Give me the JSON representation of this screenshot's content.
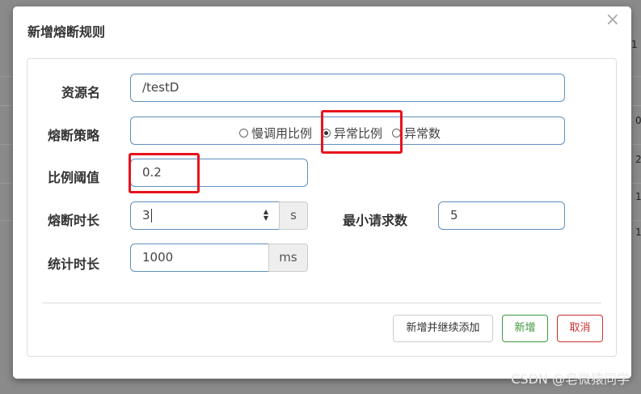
{
  "dialog": {
    "title": "新增熔断规则",
    "close_glyph": "×"
  },
  "form": {
    "resource_label": "资源名",
    "resource_value": "/testD",
    "strategy_label": "熔断策略",
    "strategy_options": [
      {
        "label": "慢调用比例",
        "selected": false
      },
      {
        "label": "异常比例",
        "selected": true
      },
      {
        "label": "异常数",
        "selected": false
      }
    ],
    "ratio_label": "比例阈值",
    "ratio_value": "0.2",
    "duration_label": "熔断时长",
    "duration_value": "3",
    "duration_unit": "s",
    "min_requests_label": "最小请求数",
    "min_requests_value": "5",
    "stat_label": "统计时长",
    "stat_value": "1000",
    "stat_unit": "ms"
  },
  "footer": {
    "add_continue_label": "新增并继续添加",
    "add_label": "新增",
    "cancel_label": "取消"
  },
  "background": {
    "edge_texts": [
      "1",
      "0",
      "2",
      "1",
      "1"
    ],
    "watermark": "CSDN @皂微猿同学"
  },
  "colors": {
    "highlight": "#e8131c",
    "input_border": "#5f8fc0",
    "add_button": "#3c9a3c",
    "cancel_button": "#c9302c"
  }
}
